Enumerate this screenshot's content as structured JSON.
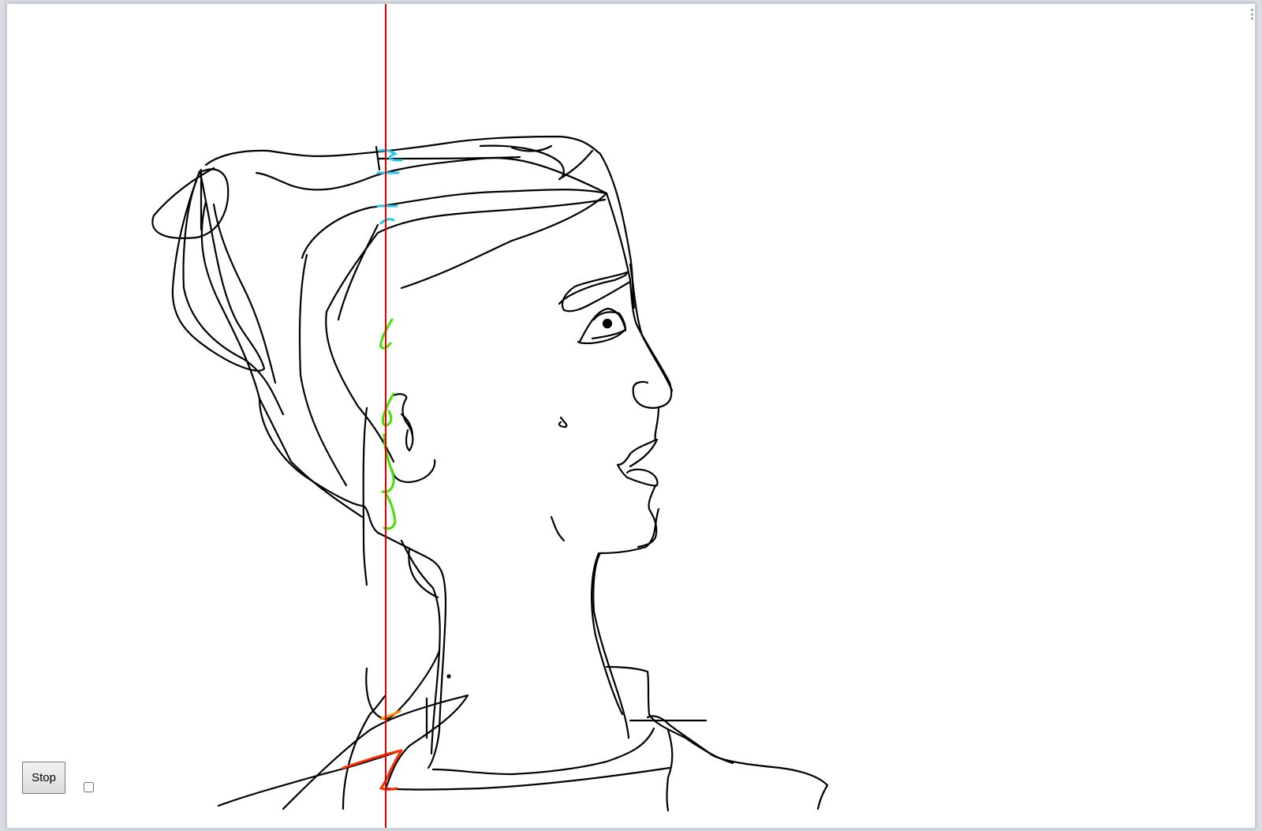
{
  "toolbar": {
    "stop_label": "Stop",
    "toggle_checked": false
  },
  "colors": {
    "stroke": "#000000",
    "scan_line": "#e00000",
    "hair_highlight": "#26c6e8",
    "face_highlight": "#44e000",
    "shoulder_highlight": "#ff2a00",
    "background": "#ffffff"
  },
  "icons": {
    "window_handle": "drag-dots-icon"
  }
}
